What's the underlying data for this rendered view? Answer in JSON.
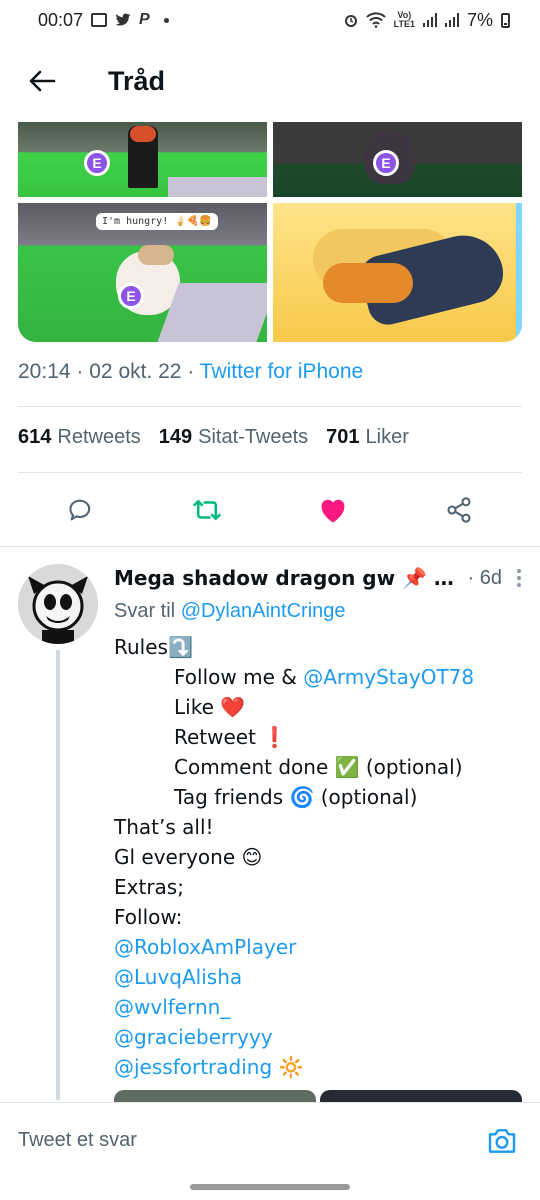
{
  "status_bar": {
    "time": "00:07",
    "twitter_glyph": "🐦",
    "p_glyph": "P",
    "lte_label": "Vo)\nLTE1",
    "battery": "7%"
  },
  "header": {
    "title": "Tråd"
  },
  "media": {
    "speech_bubble": "I'm hungry! 🍦🍕🍔",
    "badge_letter": "E"
  },
  "tweet": {
    "time": "20:14",
    "date": "02 okt. 22",
    "separator": "·",
    "source": "Twitter for iPhone",
    "stats": {
      "retweets_count": "614",
      "retweets_label": "Retweets",
      "quote_count": "149",
      "quote_label": "Sitat-Tweets",
      "likes_count": "701",
      "likes_label": "Liker"
    }
  },
  "reply": {
    "name": "Mega shadow dragon gw 📌 …",
    "time": "· 6d",
    "reply_to_prefix": "Svar til",
    "reply_to_handle": "@DylanAintCringe",
    "lines": {
      "rules": "Rules⤵️",
      "follow_prefix": "Follow me & ",
      "follow_handle": "@ArmyStayOT78",
      "like": "Like ❤️",
      "retweet": "Retweet ❗",
      "comment": "Comment done ✅ (optional)",
      "tag": "Tag friends 🌀 (optional)",
      "thats_all": "That’s all!",
      "gl": "Gl everyone 😊",
      "extras": "Extras;",
      "follow": "Follow:",
      "handle1": "@RobloxAmPlayer",
      "handle2": "@LuvqAlisha",
      "handle3": "@wvlfernn_",
      "handle4": "@gracieberryyy",
      "handle5": "@jessfortrading",
      "handle5_emoji": " 🔆"
    }
  },
  "reply_bar": {
    "placeholder": "Tweet et svar"
  },
  "colors": {
    "link": "#1d9bf0",
    "retweet_green": "#00ba7c",
    "like_pink": "#f91880",
    "muted": "#536471"
  }
}
